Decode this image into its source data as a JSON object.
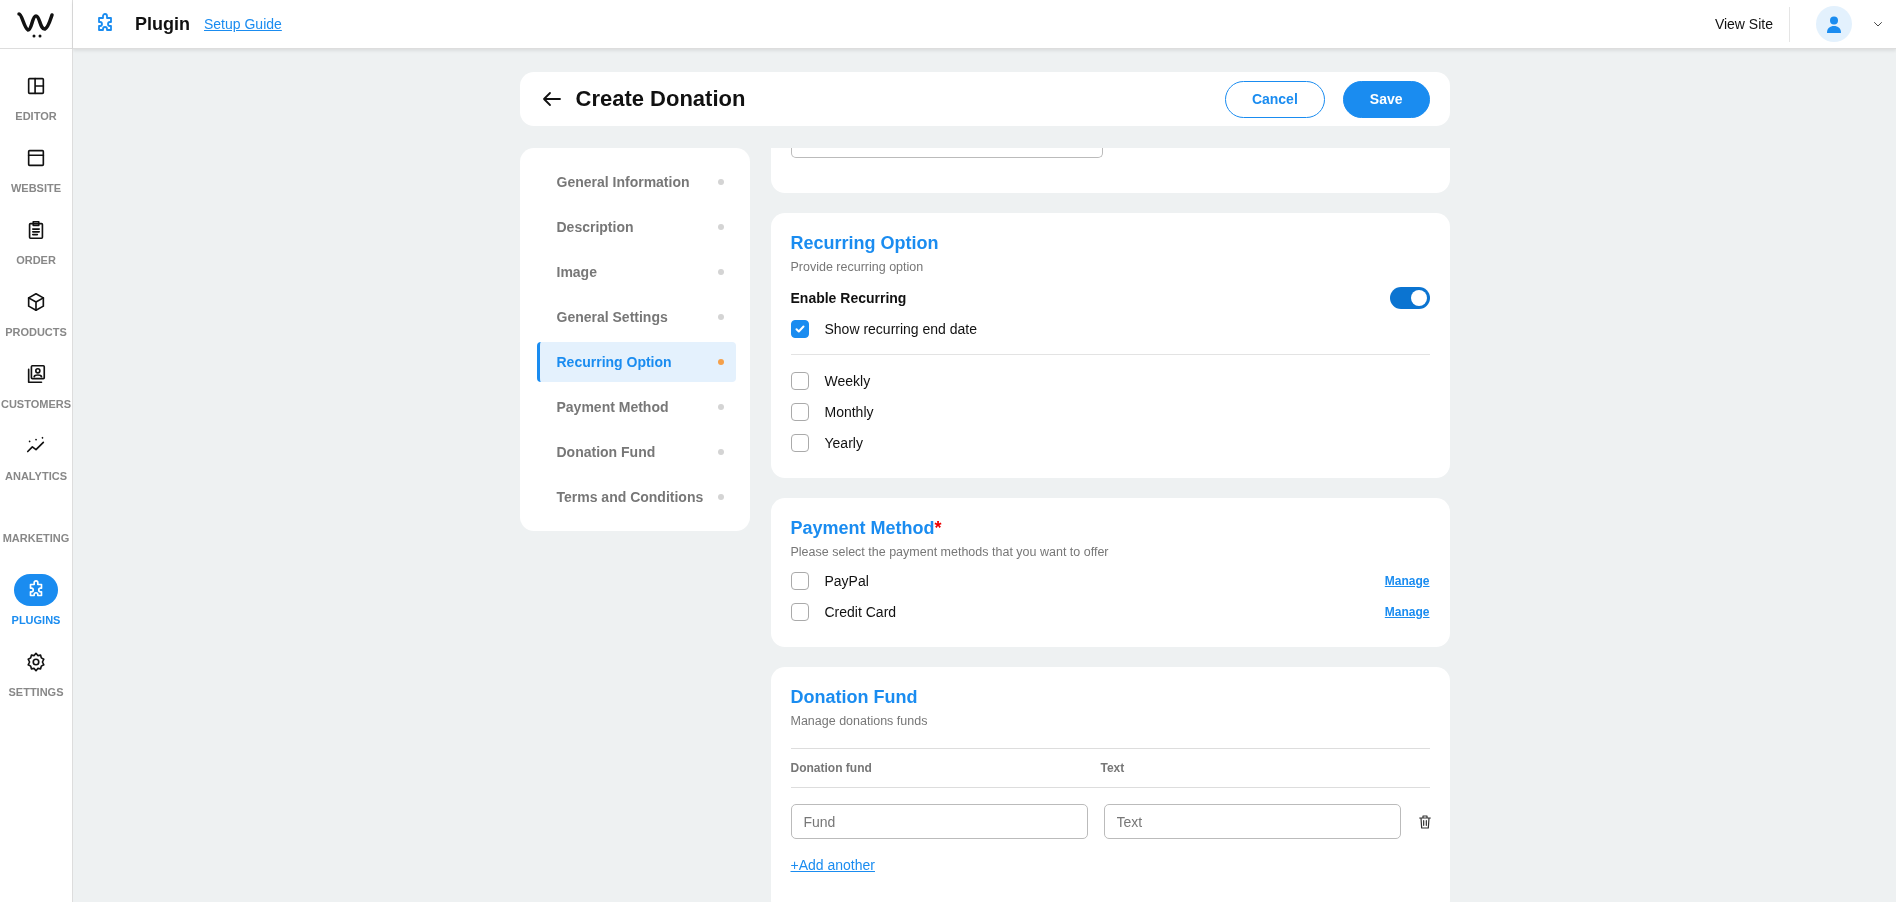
{
  "topbar": {
    "title": "Plugin",
    "link": "Setup Guide",
    "view_site": "View Site"
  },
  "sidebar": {
    "items": [
      {
        "label": "EDITOR",
        "kind": "editor",
        "selected": false
      },
      {
        "label": "WEBSITE",
        "kind": "website",
        "selected": false
      },
      {
        "label": "ORDER",
        "kind": "order",
        "selected": false
      },
      {
        "label": "PRODUCTS",
        "kind": "products",
        "selected": false
      },
      {
        "label": "CUSTOMERS",
        "kind": "customers",
        "selected": false
      },
      {
        "label": "ANALYTICS",
        "kind": "analytics",
        "selected": false
      },
      {
        "label": "MARKETING",
        "kind": "marketing",
        "selected": false
      },
      {
        "label": "PLUGINS",
        "kind": "plugins",
        "selected": true
      },
      {
        "label": "SETTINGS",
        "kind": "settings",
        "selected": false
      }
    ]
  },
  "page": {
    "title": "Create Donation",
    "buttons": [
      {
        "label": "Cancel",
        "kind": "outline"
      },
      {
        "label": "Save",
        "kind": "primary"
      }
    ]
  },
  "sections_nav": [
    {
      "label": "General Information",
      "selected": false
    },
    {
      "label": "Description",
      "selected": false
    },
    {
      "label": "Image",
      "selected": false
    },
    {
      "label": "General Settings",
      "selected": false
    },
    {
      "label": "Recurring Option",
      "selected": true
    },
    {
      "label": "Payment Method",
      "selected": false
    },
    {
      "label": "Donation Fund",
      "selected": false
    },
    {
      "label": "Terms and Conditions",
      "selected": false
    }
  ],
  "recurring": {
    "title": "Recurring Option",
    "subtitle": "Provide recurring option",
    "toggle": {
      "label": "Enable Recurring",
      "on": true
    },
    "end_date": {
      "label": "Show recurring end date",
      "checked": true
    },
    "options": [
      {
        "label": "Weekly",
        "checked": false
      },
      {
        "label": "Monthly",
        "checked": false
      },
      {
        "label": "Yearly",
        "checked": false
      }
    ]
  },
  "payment": {
    "title": "Payment Method",
    "required_mark": "*",
    "subtitle": "Please select the payment methods that you want to offer",
    "methods": [
      {
        "label": "PayPal",
        "checked": false,
        "link": "Manage"
      },
      {
        "label": "Credit Card",
        "checked": false,
        "link": "Manage"
      }
    ]
  },
  "fund": {
    "title": "Donation Fund",
    "subtitle": "Manage donations funds",
    "columns": [
      "Donation fund",
      "Text"
    ],
    "rows": [
      {
        "fund_placeholder": "Fund",
        "text_placeholder": "Text"
      }
    ],
    "add_link": "+Add another"
  }
}
